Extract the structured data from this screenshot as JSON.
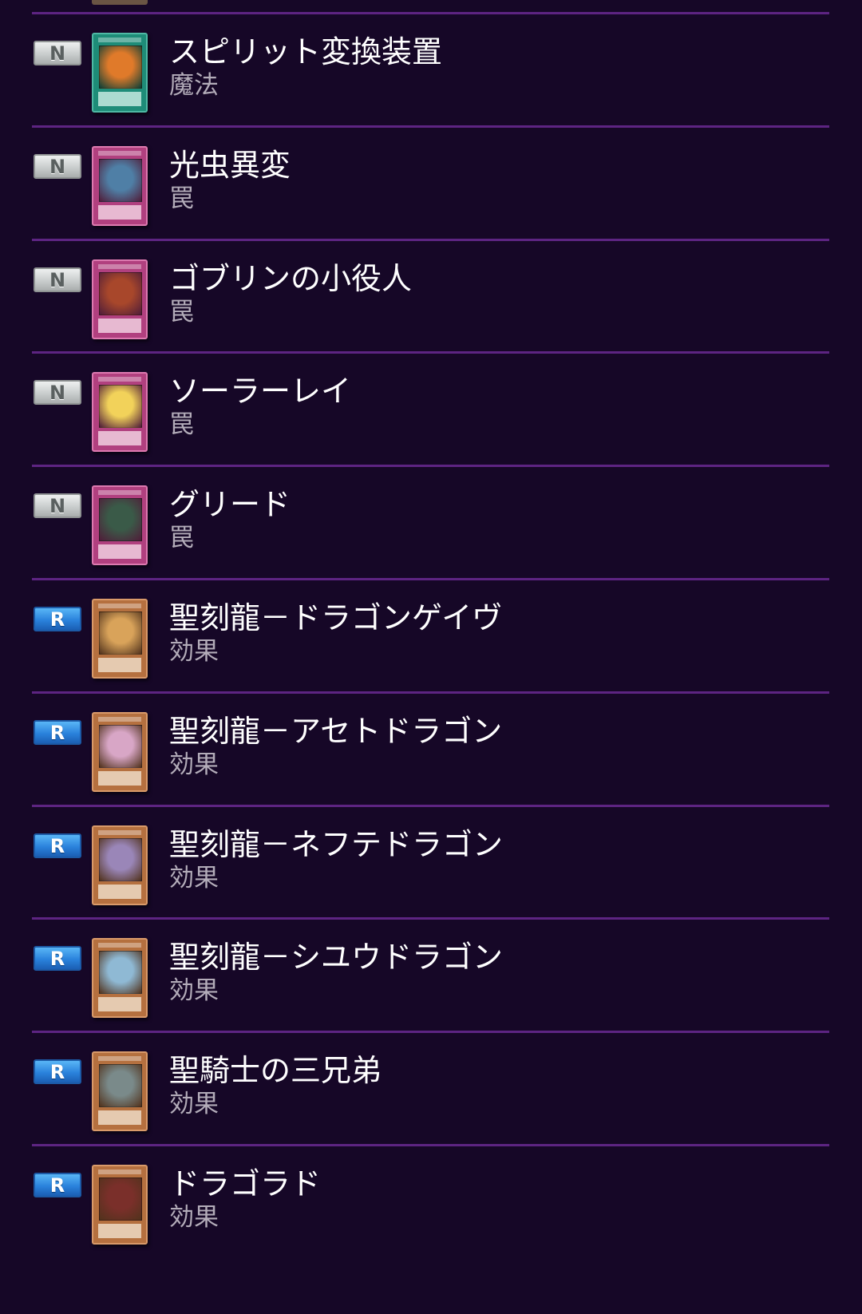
{
  "card_list": {
    "items": [
      {
        "rarity": "N",
        "name": "スピリット変換装置",
        "type": "魔法",
        "frame": "spell",
        "art_color": "#e07a2a"
      },
      {
        "rarity": "N",
        "name": "光虫異変",
        "type": "罠",
        "frame": "trap",
        "art_color": "#4f7fa6"
      },
      {
        "rarity": "N",
        "name": "ゴブリンの小役人",
        "type": "罠",
        "frame": "trap",
        "art_color": "#a8472b"
      },
      {
        "rarity": "N",
        "name": "ソーラーレイ",
        "type": "罠",
        "frame": "trap",
        "art_color": "#f2d25a"
      },
      {
        "rarity": "N",
        "name": "グリード",
        "type": "罠",
        "frame": "trap",
        "art_color": "#3a5a48"
      },
      {
        "rarity": "R",
        "name": "聖刻龍－ドラゴンゲイヴ",
        "type": "効果",
        "frame": "effect",
        "art_color": "#d9a35a"
      },
      {
        "rarity": "R",
        "name": "聖刻龍－アセトドラゴン",
        "type": "効果",
        "frame": "effect",
        "art_color": "#d8a6c6"
      },
      {
        "rarity": "R",
        "name": "聖刻龍－ネフテドラゴン",
        "type": "効果",
        "frame": "effect",
        "art_color": "#9a86b8"
      },
      {
        "rarity": "R",
        "name": "聖刻龍－シユウドラゴン",
        "type": "効果",
        "frame": "effect",
        "art_color": "#8fb9d4"
      },
      {
        "rarity": "R",
        "name": "聖騎士の三兄弟",
        "type": "効果",
        "frame": "effect",
        "art_color": "#7a8a8a"
      },
      {
        "rarity": "R",
        "name": "ドラゴラド",
        "type": "効果",
        "frame": "effect",
        "art_color": "#7a2f2a"
      }
    ]
  },
  "colors": {
    "background": "#160727",
    "divider": "#5d2482",
    "rarity_n": "#c9cdcd",
    "rarity_r": "#2a82dc"
  }
}
